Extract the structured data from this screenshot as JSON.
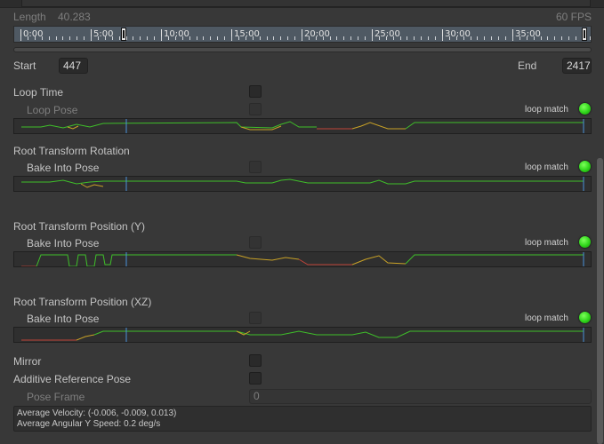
{
  "length": {
    "label": "Length",
    "value": "40.283",
    "fps": "60 FPS"
  },
  "timeline": {
    "ticks": [
      "0:00",
      "5:00",
      "10:00",
      "15:00",
      "20:00",
      "25:00",
      "30:00",
      "35:00"
    ]
  },
  "start": {
    "label": "Start",
    "value": "447"
  },
  "end": {
    "label": "End",
    "value": "2417"
  },
  "loop_time": {
    "label": "Loop Time",
    "checked": false
  },
  "loop_pose": {
    "label": "Loop Pose",
    "checked": false,
    "loop_match": "loop match",
    "status_color": "#2fd41a"
  },
  "root_rotation": {
    "heading": "Root Transform Rotation",
    "bake_label": "Bake Into Pose",
    "checked": false,
    "loop_match": "loop match",
    "status_color": "#2fd41a"
  },
  "root_position_y": {
    "heading": "Root Transform Position (Y)",
    "bake_label": "Bake Into Pose",
    "checked": false,
    "loop_match": "loop match",
    "status_color": "#2fd41a"
  },
  "root_position_xz": {
    "heading": "Root Transform Position (XZ)",
    "bake_label": "Bake Into Pose",
    "checked": false,
    "loop_match": "loop match",
    "status_color": "#2fd41a"
  },
  "mirror": {
    "label": "Mirror",
    "checked": false
  },
  "additive": {
    "label": "Additive Reference Pose",
    "checked": false
  },
  "pose_frame": {
    "label": "Pose Frame",
    "value": "0"
  },
  "info": {
    "velocity": "Average Velocity: (-0.006, -0.009, 0.013)",
    "angular": "Average Angular Y Speed: 0.2 deg/s"
  },
  "colors": {
    "good": "#3fbf2a",
    "warn": "#c9a227",
    "bad": "#c0443a",
    "marker": "#4a90d9"
  }
}
